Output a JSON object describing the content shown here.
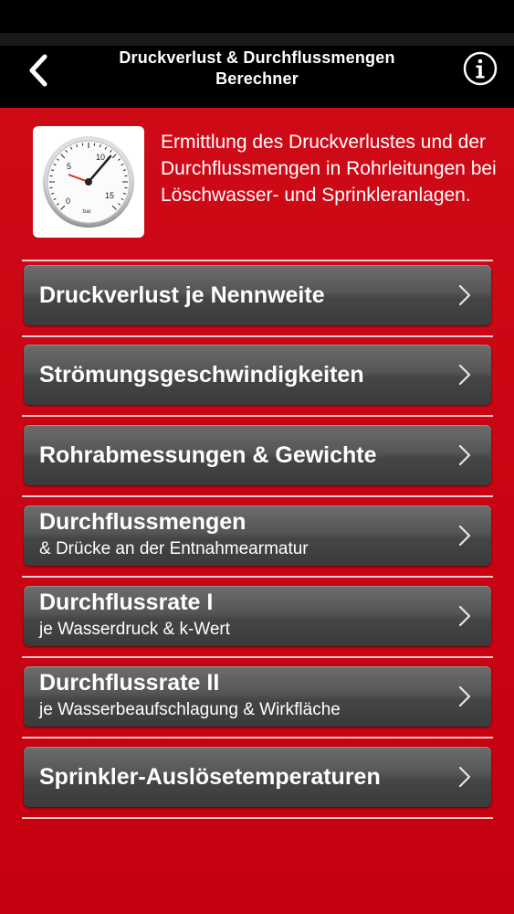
{
  "navbar": {
    "title": "Druckverlust & Durchflussmengen Berechner",
    "back_icon": "chevron-left-icon",
    "info_icon": "info-icon"
  },
  "intro": {
    "text": "Ermittlung des Druckverlustes und der Durchflussmengen in Rohrleitungen bei Löschwasser- und Sprinkleranlagen.",
    "gauge": {
      "ticks": [
        "0",
        "5",
        "10",
        "15"
      ],
      "unit": "bar"
    }
  },
  "menu": {
    "items": [
      {
        "title": "Druckverlust je Nennweite",
        "subtitle": ""
      },
      {
        "title": "Strömungsgeschwindigkeiten",
        "subtitle": ""
      },
      {
        "title": "Rohrabmessungen & Gewichte",
        "subtitle": ""
      },
      {
        "title": "Durchflussmengen",
        "subtitle": "& Drücke an der Entnahmearmatur"
      },
      {
        "title": "Durchflussrate I",
        "subtitle": "je Wasserdruck & k-Wert"
      },
      {
        "title": "Durchflussrate II",
        "subtitle": "je Wasserbeaufschlagung & Wirkfläche"
      },
      {
        "title": "Sprinkler-Auslösetemperaturen",
        "subtitle": ""
      }
    ]
  },
  "colors": {
    "background": "#c8000f",
    "navbar": "#000000",
    "button": "#4a4a4a",
    "text": "#ffffff"
  }
}
